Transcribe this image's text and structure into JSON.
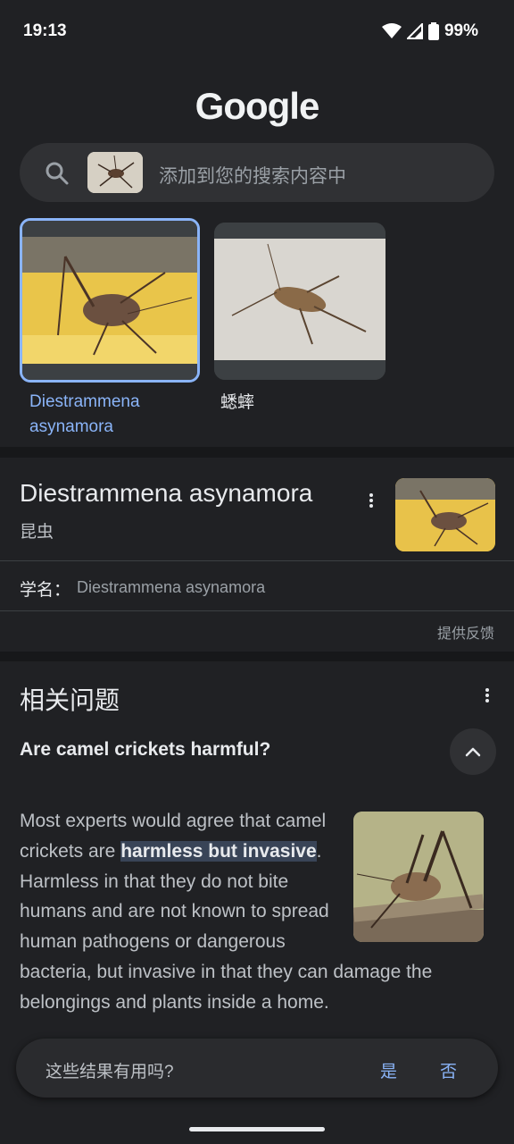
{
  "status_bar": {
    "time": "19:13",
    "battery": "99%"
  },
  "logo": "Google",
  "search": {
    "placeholder": "添加到您的搜索内容中"
  },
  "candidates": [
    {
      "label": "Diestrammena asynamora",
      "selected": true
    },
    {
      "label": "蟋蟀",
      "selected": false
    }
  ],
  "knowledge_panel": {
    "title": "Diestrammena asynamora",
    "subtitle": "昆虫",
    "scientific_name_label": "学名：",
    "scientific_name_value": "Diestrammena asynamora",
    "feedback": "提供反馈"
  },
  "related_questions": {
    "heading": "相关问题",
    "question": "Are camel crickets harmful?",
    "answer_before": "Most experts would agree that camel crickets are ",
    "answer_highlight": "harmless but invasive",
    "answer_after": ". Harmless in that they do not bite humans and are not known to spread human pathogens or dangerous bacteria, but invasive in that they can damage the belongings and plants inside a home."
  },
  "feedback_bar": {
    "question": "这些结果有用吗?",
    "yes": "是",
    "no": "否"
  },
  "colors": {
    "accent": "#8ab4f8",
    "background": "#202124",
    "surface": "#303134"
  }
}
